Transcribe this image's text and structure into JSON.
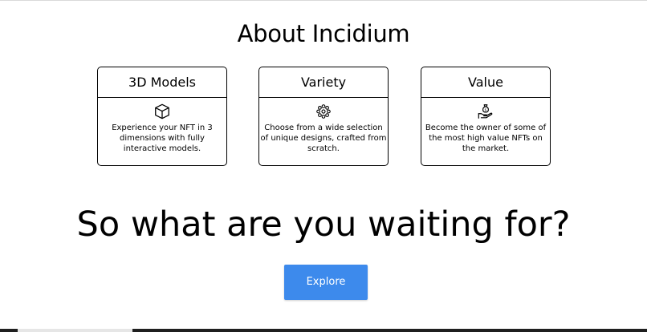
{
  "about": {
    "title": "About Incidium"
  },
  "features": [
    {
      "title": "3D Models",
      "icon": "cube-icon",
      "description": "Experience your NFT in 3 dimensions with fully interactive models."
    },
    {
      "title": "Variety",
      "icon": "flower-pattern-icon",
      "description": "Choose from a wide selection of unique designs, crafted from scratch."
    },
    {
      "title": "Value",
      "icon": "money-bag-hand-icon",
      "description": "Become the owner of some of the most high value NFTs on the market."
    }
  ],
  "cta": {
    "heading": "So what are you waiting for?",
    "button_label": "Explore",
    "button_color": "#3d8aec"
  }
}
